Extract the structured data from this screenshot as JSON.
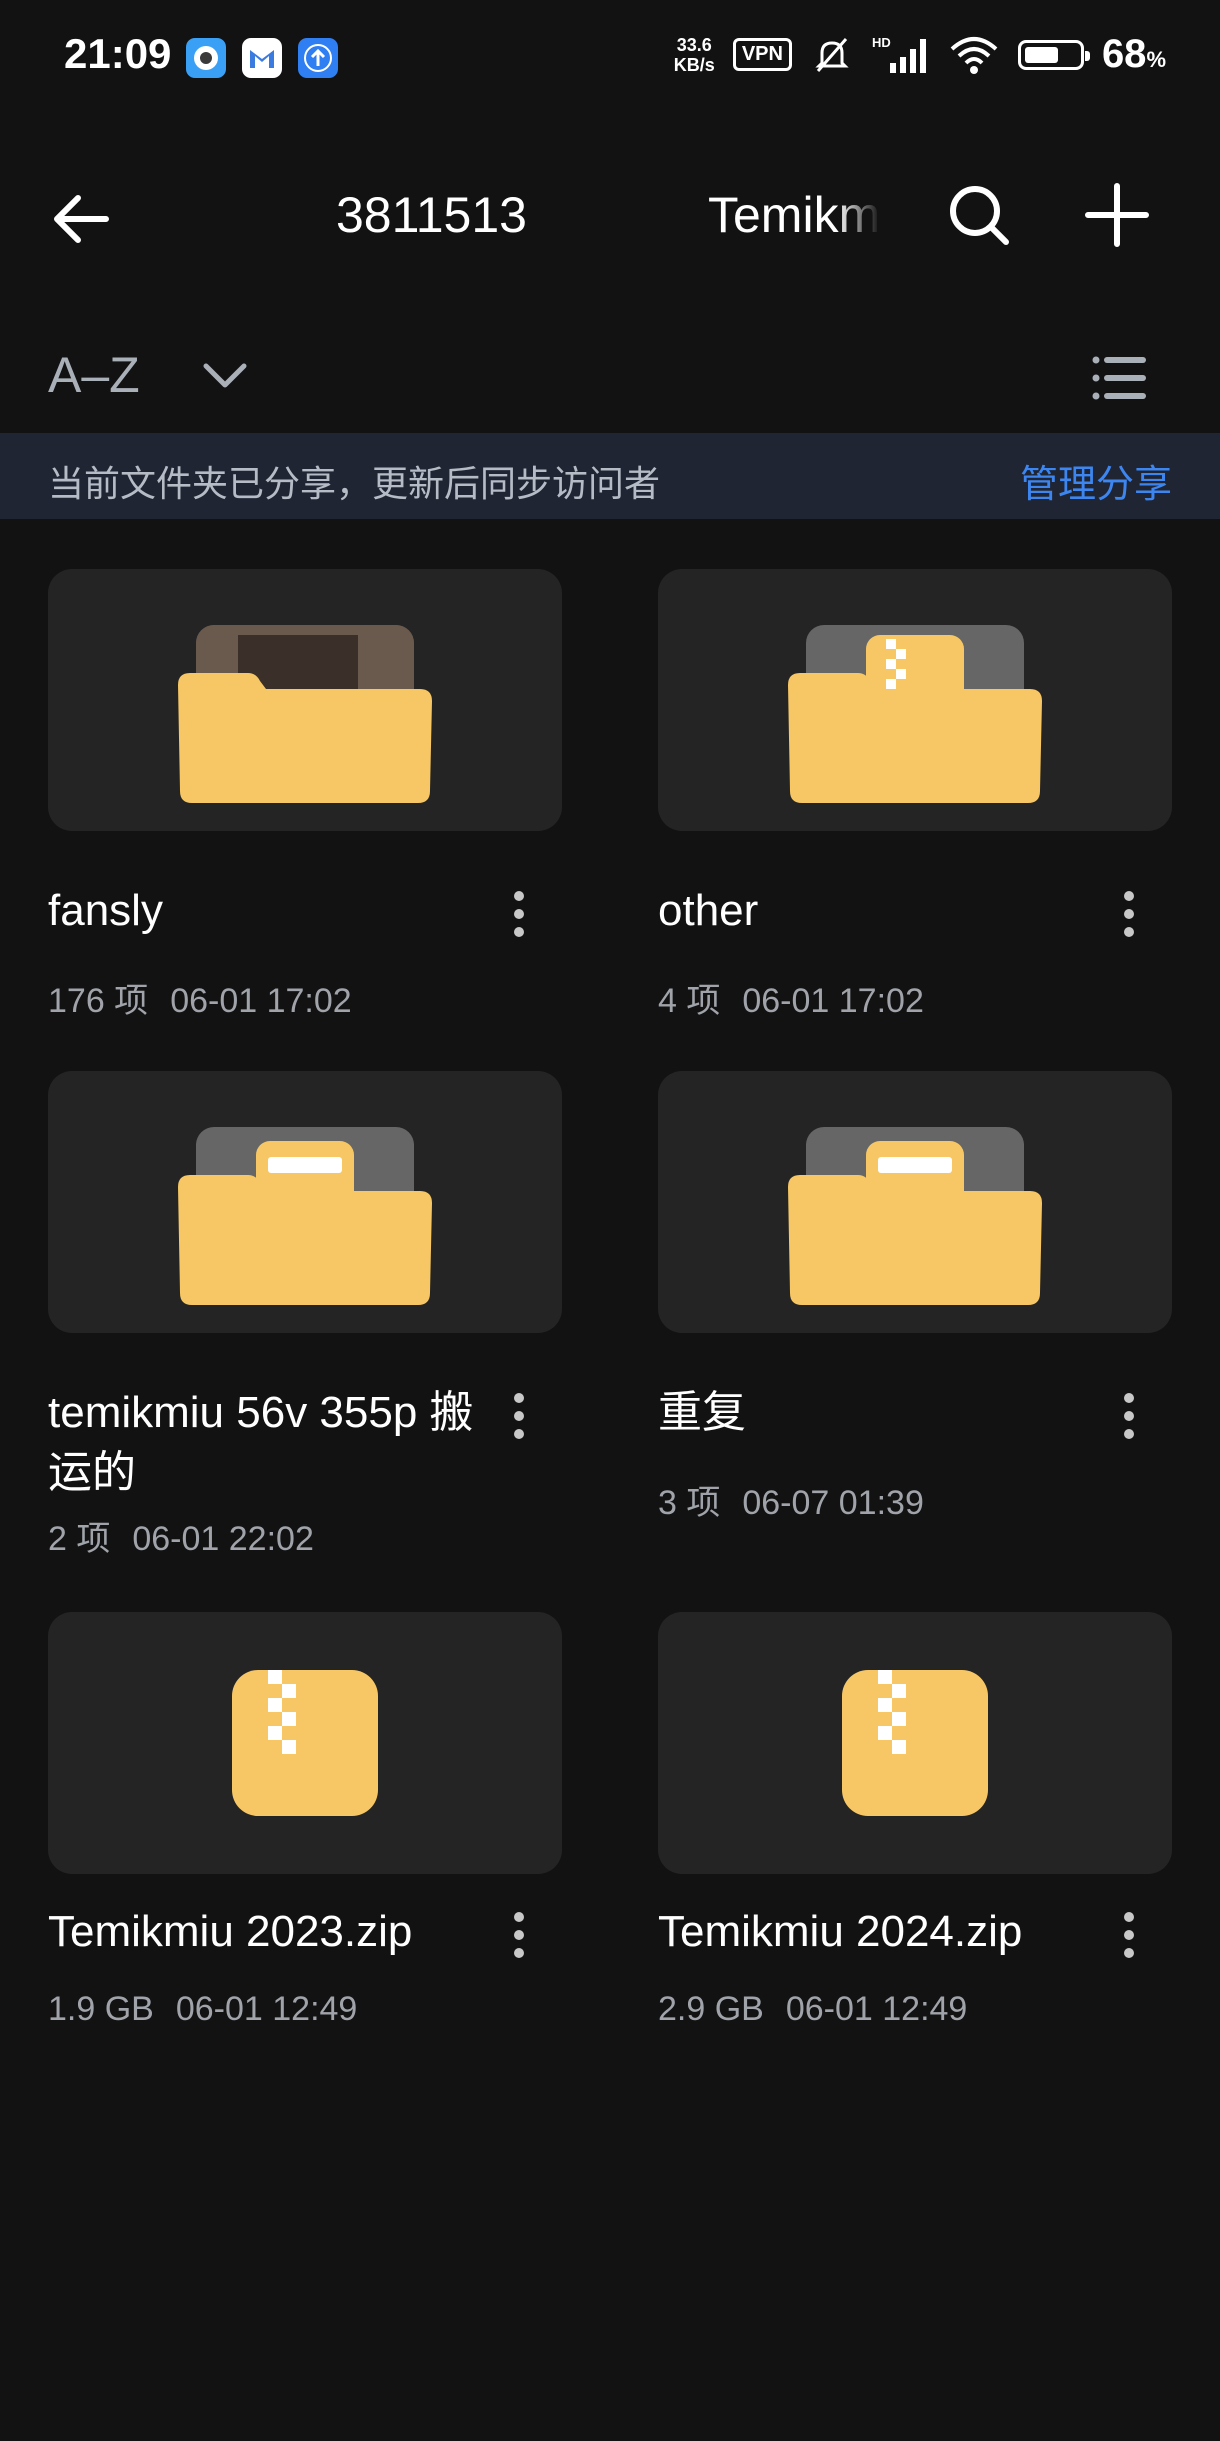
{
  "status_bar": {
    "time": "21:09",
    "speed_value": "33.6",
    "speed_unit": "KB/s",
    "vpn": "VPN",
    "battery_level": 0.68,
    "battery_pct": "68",
    "battery_unit": "%",
    "icons": [
      "notification-app-1-icon",
      "gmail-icon",
      "upload-app-icon",
      "mute-icon",
      "signal-icon",
      "wifi-icon",
      "battery-icon"
    ]
  },
  "toolbar": {
    "crumb_prev_visible": "3811513",
    "crumb_current": "Temikmiu",
    "icons": [
      "back-arrow-icon",
      "search-icon",
      "plus-icon"
    ]
  },
  "sort": {
    "label": "A–Z",
    "icons": [
      "chevron-down-icon",
      "list-view-icon"
    ]
  },
  "banner": {
    "text": "当前文件夹已分享，更新后同步访问者",
    "action": "管理分享"
  },
  "colors": {
    "background": "#121212",
    "card": "#242424",
    "folder": "#f6c764",
    "accent": "#3d86f0",
    "banner_bg": "#1f2533"
  },
  "items": [
    {
      "name": "fansly",
      "count": "176 项",
      "date": "06-01 17:02",
      "icon": "folder-photo-icon"
    },
    {
      "name": "other",
      "count": "4 项",
      "date": "06-01 17:02",
      "icon": "folder-archive-icon"
    },
    {
      "name": "temikmiu 56v 355p 搬运的",
      "count": "2 项",
      "date": "06-01 22:02",
      "icon": "folder-document-icon"
    },
    {
      "name": "重复",
      "count": "3 项",
      "date": "06-07 01:39",
      "icon": "folder-document-icon"
    },
    {
      "name": "Temikmiu 2023.zip",
      "count": "1.9 GB",
      "date": "06-01 12:49",
      "icon": "zip-file-icon"
    },
    {
      "name": "Temikmiu 2024.zip",
      "count": "2.9 GB",
      "date": "06-01 12:49",
      "icon": "zip-file-icon"
    }
  ]
}
